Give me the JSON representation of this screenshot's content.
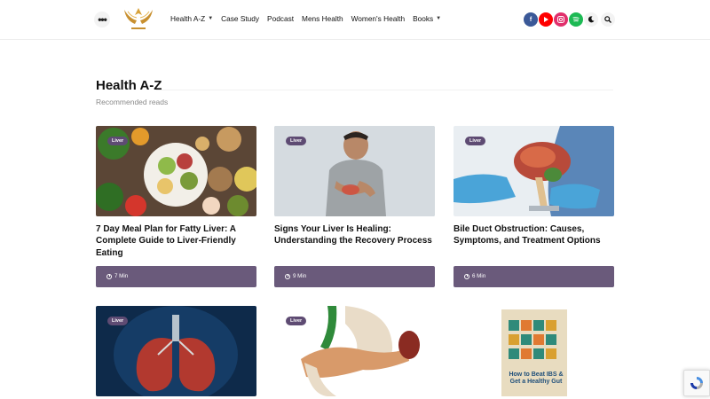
{
  "header": {
    "menu_icon": "more-dots-icon",
    "nav": [
      {
        "label": "Health A-Z",
        "dropdown": true
      },
      {
        "label": "Case Study",
        "dropdown": false
      },
      {
        "label": "Podcast",
        "dropdown": false
      },
      {
        "label": "Mens Health",
        "dropdown": false
      },
      {
        "label": "Women's Health",
        "dropdown": false
      },
      {
        "label": "Books",
        "dropdown": true
      }
    ],
    "social": [
      {
        "name": "facebook",
        "color": "#3b5998"
      },
      {
        "name": "youtube",
        "color": "#ff0000"
      },
      {
        "name": "instagram",
        "color": "#e1306c"
      },
      {
        "name": "spotify",
        "color": "#1db954"
      }
    ],
    "dark_mode_icon": "moon-icon",
    "search_icon": "search-icon"
  },
  "section": {
    "title": "Health A-Z",
    "subtitle": "Recommended reads"
  },
  "cards": [
    {
      "tag": "Liver",
      "title": "7 Day Meal Plan for Fatty Liver: A Complete Guide to Liver-Friendly Eating",
      "read_time": "7 Min"
    },
    {
      "tag": "Liver",
      "title": "Signs Your Liver Is Healing: Understanding the Recovery Process",
      "read_time": "9 Min"
    },
    {
      "tag": "Liver",
      "title": "Bile Duct Obstruction: Causes, Symptoms, and Treatment Options",
      "read_time": "6 Min"
    },
    {
      "tag": "Liver"
    },
    {
      "tag": "Liver"
    },
    {
      "book_cover_text": "How to Beat IBS & Get a Healthy Gut"
    }
  ],
  "colors": {
    "accent": "#6a5a7b",
    "tag_bg": "#5e4b73"
  }
}
